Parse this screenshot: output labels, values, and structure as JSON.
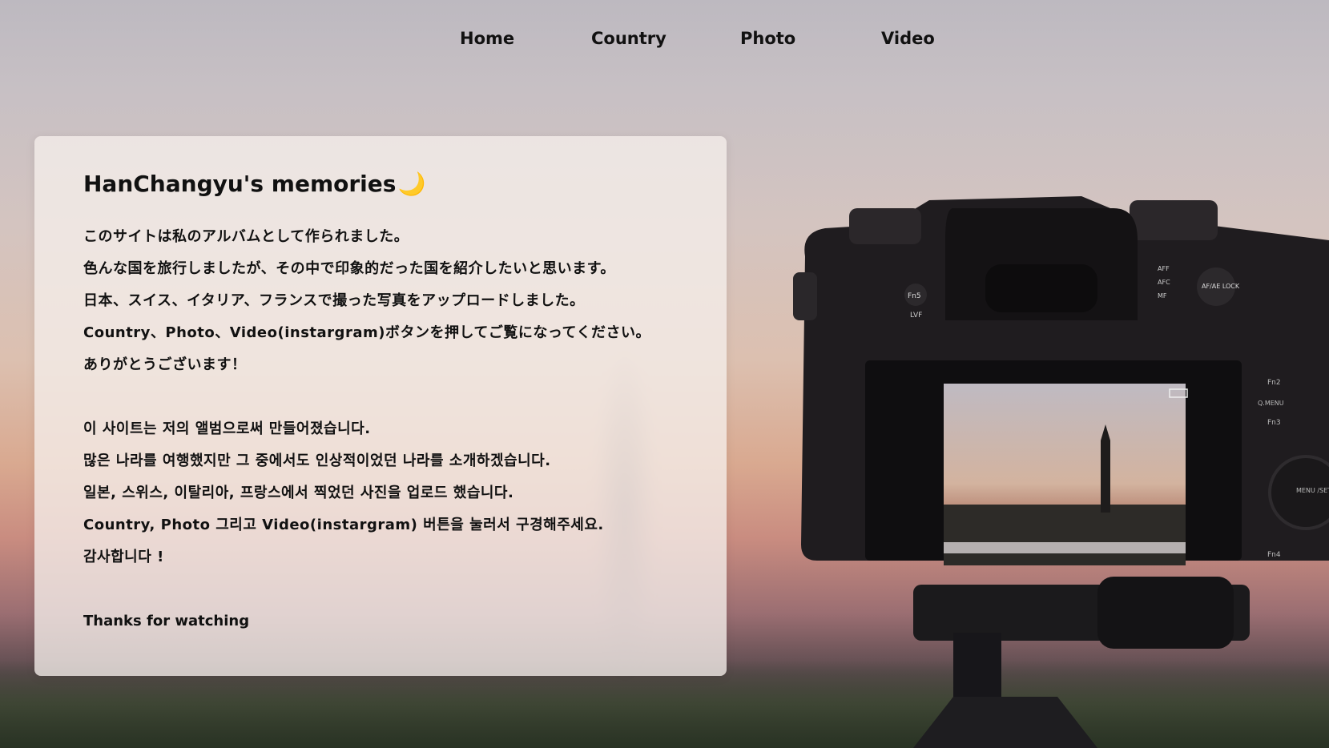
{
  "nav": {
    "items": [
      {
        "label": "Home"
      },
      {
        "label": "Country"
      },
      {
        "label": "Photo"
      },
      {
        "label": "Video"
      }
    ]
  },
  "card": {
    "title": "HanChangyu's memories",
    "title_emoji": "🌙",
    "japanese": [
      "このサイトは私のアルバムとして作られました。",
      "色んな国を旅行しましたが、その中で印象的だった国を紹介したいと思います。",
      "日本、スイス、イタリア、フランスで撮った写真をアップロードしました。",
      "Country、Photo、Video(instargram)ボタンを押してご覧になってください。",
      "ありがとうございます！"
    ],
    "korean": [
      "이 사이트는 저의 앨범으로써 만들어졌습니다.",
      "많은 나라를 여행했지만 그 중에서도 인상적이었던 나라를 소개하겠습니다.",
      "일본, 스위스, 이탈리아, 프랑스에서 찍었던 사진을 업로드 했습니다.",
      "Country, Photo 그리고 Video(instargram) 버튼을 눌러서 구경해주세요.",
      "감사합니다 !"
    ],
    "closing": "Thanks for watching"
  },
  "camera": {
    "buttons": {
      "fn5": "Fn5",
      "lvf": "LVF",
      "afae": "AF/AE LOCK",
      "fn2": "Fn2",
      "qmenu": "Q.MENU",
      "fn3": "Fn3",
      "fn4": "Fn4",
      "menu": "MENU /SET",
      "mode_afs": "AFF",
      "mode_afc": "AFC",
      "mode_mf": "MF"
    }
  },
  "colors": {
    "text": "#111111",
    "card_bg": "#f5eeea",
    "moon": "#e0a500"
  }
}
